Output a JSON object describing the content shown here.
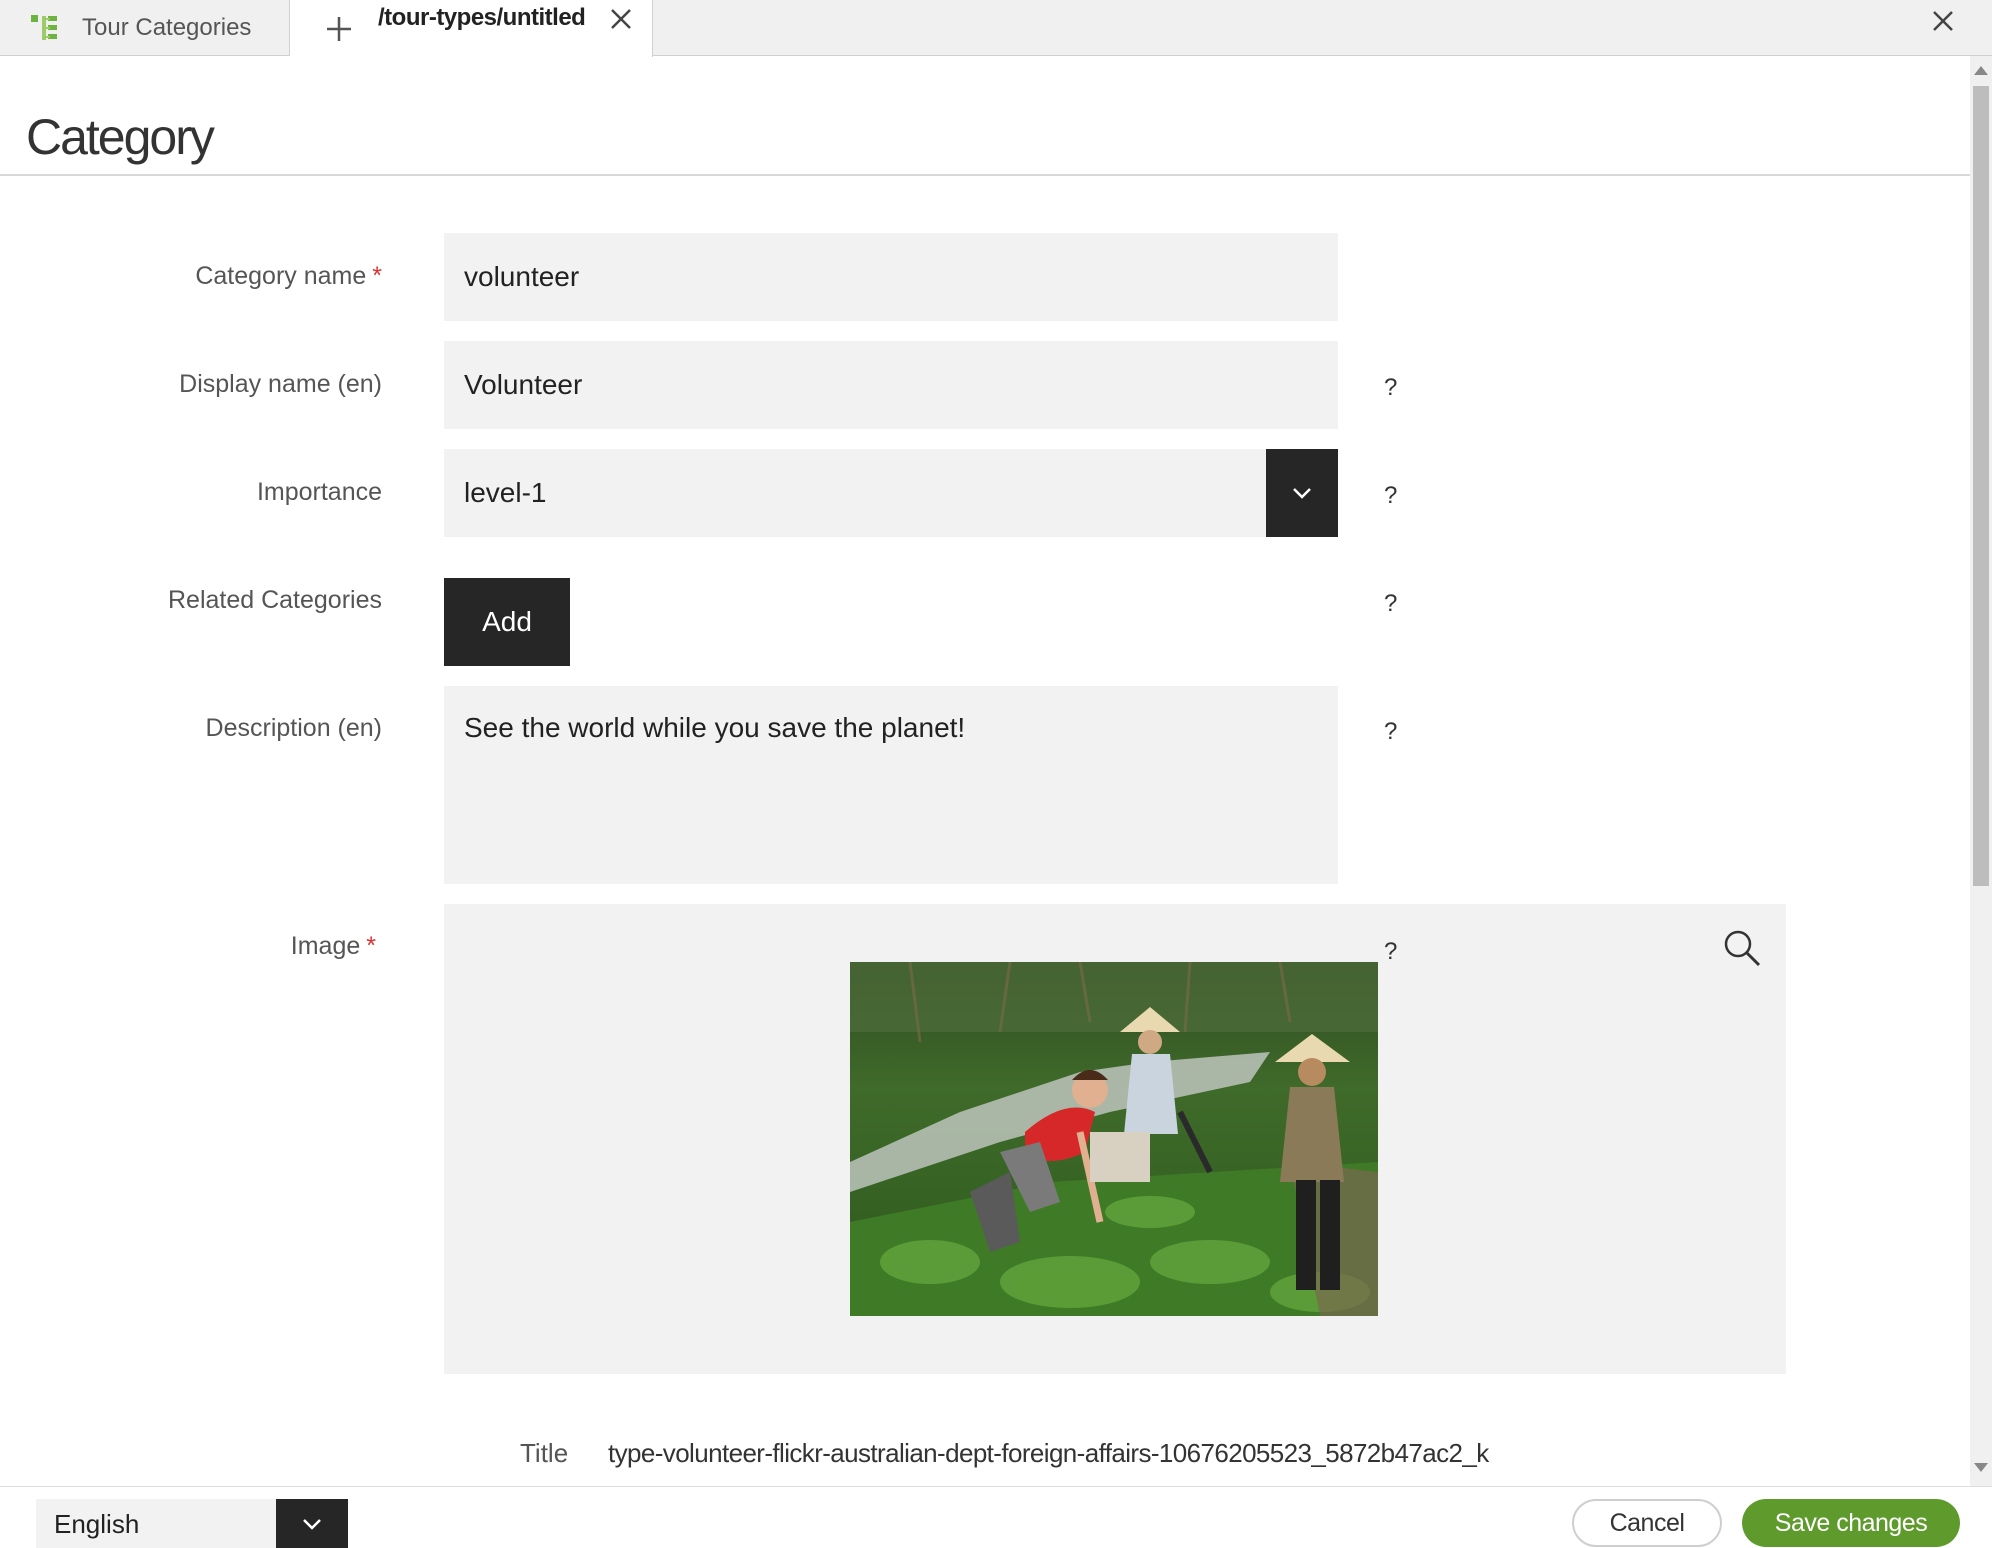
{
  "tabs": [
    {
      "label": "Tour Categories",
      "icon": "tree-icon"
    },
    {
      "label": "/tour-types/untitled",
      "icon": "plus-icon"
    }
  ],
  "page": {
    "title": "Category"
  },
  "form": {
    "category_name": {
      "label": "Category name",
      "required_mark": "*",
      "value": "volunteer"
    },
    "display_name": {
      "label": "Display name (en)",
      "value": "Volunteer",
      "help": "?"
    },
    "importance": {
      "label": "Importance",
      "value": "level-1",
      "help": "?"
    },
    "related_categories": {
      "label": "Related Categories",
      "button_label": "Add",
      "help": "?"
    },
    "description": {
      "label": "Description (en)",
      "value": "See the world while you save the planet!",
      "help": "?"
    },
    "image": {
      "label": "Image",
      "required_mark": "*",
      "help": "?",
      "title_label": "Title",
      "title_value": "type-volunteer-flickr-australian-dept-foreign-affairs-10676205523_5872b47ac2_k"
    }
  },
  "footer": {
    "language": "English",
    "cancel_label": "Cancel",
    "save_label": "Save changes"
  },
  "colors": {
    "accent_green": "#5f9a2c",
    "dark_button": "#262626",
    "field_bg": "#f2f2f2",
    "required": "#e03030",
    "tree_icon": "#6db33f"
  }
}
